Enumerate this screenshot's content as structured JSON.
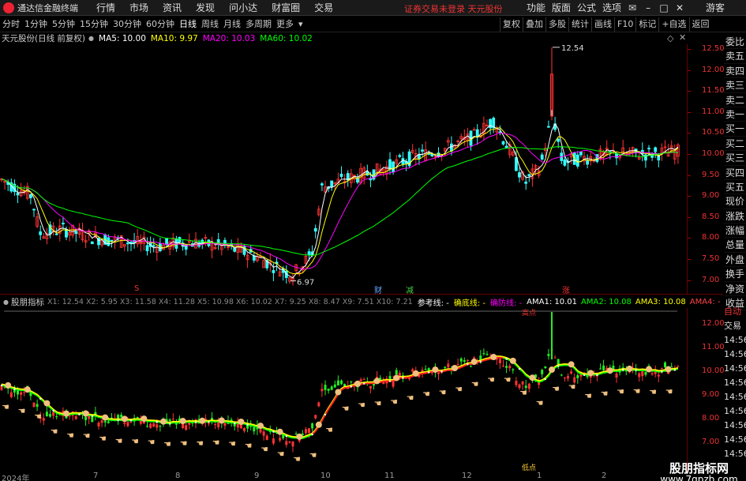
{
  "app": {
    "name": "通达信金融终端",
    "menu": [
      "行情",
      "市场",
      "资讯",
      "发现",
      "问小达",
      "财富圈",
      "交易"
    ],
    "notice": "证券交易未登录  天元股份",
    "right_menu": [
      "功能",
      "版面",
      "公式",
      "选项"
    ],
    "guest": "游客"
  },
  "toolbar": {
    "periods": [
      "分时",
      "1分钟",
      "5分钟",
      "15分钟",
      "30分钟",
      "60分钟",
      "日线",
      "周线",
      "月线",
      "多周期",
      "更多"
    ],
    "active_period": "日线",
    "buttons": [
      "复权",
      "叠加",
      "多股",
      "统计",
      "画线",
      "F10",
      "标记",
      "+自选",
      "返回"
    ]
  },
  "chart_info": {
    "title": "天元股份(日线 前复权)",
    "ma5": "MA5: 10.00",
    "ma10": "MA10: 9.97",
    "ma20": "MA20: 10.03",
    "ma60": "MA60: 10.02",
    "colors": {
      "ma5": "#ffffff",
      "ma10": "#ffff00",
      "ma20": "#ff00ff",
      "ma60": "#00ff00"
    }
  },
  "price_axis": {
    "labels": [
      "12.50",
      "12.00",
      "11.50",
      "11.00",
      "10.50",
      "10.00",
      "9.50",
      "9.00",
      "8.50",
      "8.00",
      "7.50",
      "7.00"
    ],
    "high_mark": "12.54",
    "low_mark": "6.97"
  },
  "chart_markers": {
    "s": "S",
    "cai": "财",
    "jian": "减",
    "zhang": "涨"
  },
  "indicator": {
    "name": "股朋指标",
    "x_values": "X1: 12.54  X2: 5.95  X3: 11.58  X4: 11.28  X5: 10.98  X6: 10.02  X7: 9.25  X8: 8.47  X9: 7.51  X10: 7.21",
    "ref_line": "参考线: -",
    "bottom_line": "确底线: -",
    "defense_line": "确防线: -",
    "ama1": "AMA1: 10.01",
    "ama2": "AMA2: 10.08",
    "ama3": "AMA3: 10.08",
    "ama4": "AMA4: -",
    "top_label": "高点",
    "bottom_label": "低点"
  },
  "ind_axis": {
    "labels": [
      "12.00",
      "11.00",
      "10.00",
      "9.00",
      "8.00",
      "7.00"
    ]
  },
  "sidebar": [
    "委比",
    "卖五",
    "卖四",
    "卖三",
    "卖二",
    "卖一",
    "买一",
    "买二",
    "买三",
    "买四",
    "买五",
    "现价",
    "涨跌",
    "涨幅",
    "总量",
    "外盘",
    "换手",
    "净资",
    "收益"
  ],
  "sidebar2": [
    "自动",
    "交易",
    "14:56",
    "14:56",
    "14:56",
    "14:56",
    "14:56",
    "14:56",
    "14:56",
    "14:56",
    "14:56"
  ],
  "dates": [
    "2024年",
    "7",
    "8",
    "9",
    "10",
    "11",
    "12",
    "1",
    "2"
  ],
  "watermark": {
    "line1": "股朋指标网",
    "line2": "www.7gpzb.com"
  }
}
